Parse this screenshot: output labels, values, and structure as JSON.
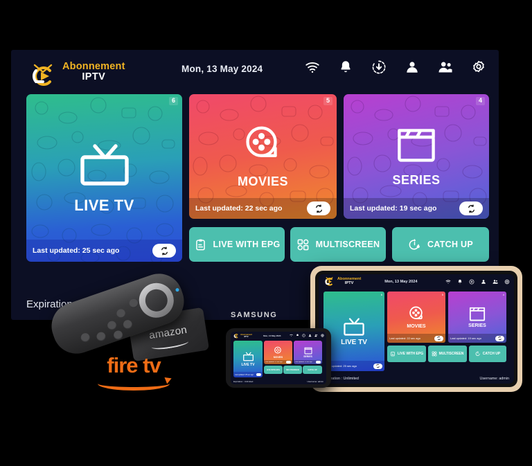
{
  "app": {
    "logo_line1": "Abonnement",
    "logo_line2": "IPTV",
    "date": "Mon, 13 May 2024",
    "expiration_label": "Expiration :  Unlimited",
    "username_label": "Username: admin",
    "accent_teal": "#4cbfae",
    "accent_gold": "#f0b323",
    "screen_bg": "#0c0f24"
  },
  "header_icons": [
    {
      "name": "wifi-icon"
    },
    {
      "name": "bell-icon"
    },
    {
      "name": "download-circle-icon"
    },
    {
      "name": "user-icon"
    },
    {
      "name": "users-group-icon"
    },
    {
      "name": "gear-icon"
    }
  ],
  "cards": [
    {
      "id": "live",
      "title": "LIVE TV",
      "badge": "6",
      "updated": "Last updated: 25 sec ago",
      "icon": "television-icon",
      "refresh_icon": "refresh-icon",
      "gradient_from": "#2fbd8c",
      "gradient_to": "#2b4fd6"
    },
    {
      "id": "movies",
      "title": "MOVIES",
      "badge": "5",
      "updated": "Last updated: 22 sec ago",
      "icon": "film-reel-icon",
      "refresh_icon": "refresh-icon",
      "gradient_from": "#f0496a",
      "gradient_to": "#ef8b2c"
    },
    {
      "id": "series",
      "title": "SERIES",
      "badge": "4",
      "updated": "Last updated: 19 sec ago",
      "icon": "clapperboard-icon",
      "refresh_icon": "refresh-icon",
      "gradient_from": "#b83fd0",
      "gradient_to": "#4f63d8"
    }
  ],
  "quick_buttons": [
    {
      "label": "LIVE WITH EPG",
      "icon": "clipboard-icon"
    },
    {
      "label": "MULTISCREEN",
      "icon": "grid-icon"
    },
    {
      "label": "CATCH UP",
      "icon": "timer-icon"
    }
  ],
  "devices": {
    "firestick_brand": "amazon",
    "firetv_logo_text": "fire tv",
    "phone_brand": "SAMSUNG"
  }
}
